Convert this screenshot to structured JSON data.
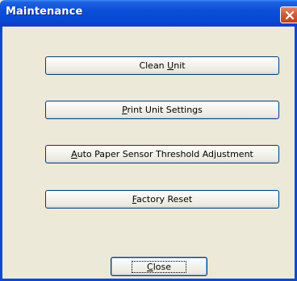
{
  "window": {
    "title": "Maintenance"
  },
  "buttons": {
    "clean_unit": {
      "pre": "Clean ",
      "mnemonic": "U",
      "post": "nit"
    },
    "print_unit_settings": {
      "pre": "",
      "mnemonic": "P",
      "post": "rint Unit Settings"
    },
    "auto_paper_sensor": {
      "pre": "",
      "mnemonic": "A",
      "post": "uto Paper Sensor Threshold Adjustment"
    },
    "factory_reset": {
      "pre": "",
      "mnemonic": "F",
      "post": "actory Reset"
    },
    "close": {
      "pre": "",
      "mnemonic": "C",
      "post": "lose"
    }
  },
  "icons": {
    "close": "close-x-icon"
  },
  "colors": {
    "titlebar": "#0a4fd8",
    "window_bg": "#ece9d8",
    "close_button": "#d55a3a",
    "button_border": "#003c74"
  }
}
